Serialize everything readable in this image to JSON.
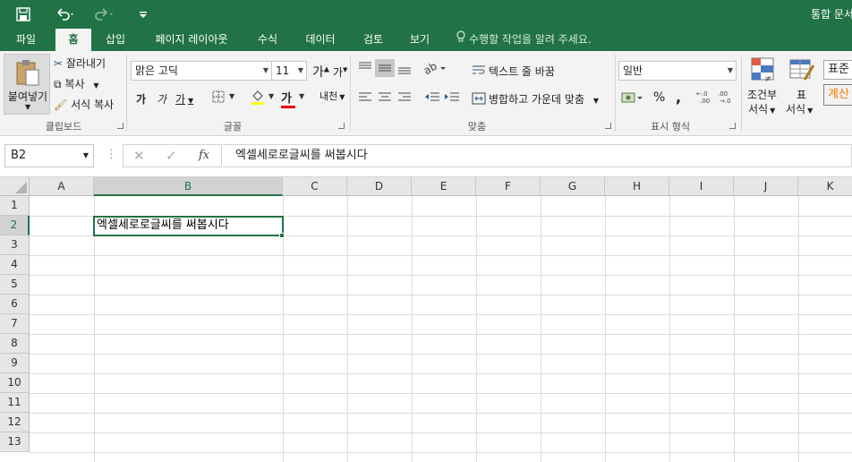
{
  "titlebar": {
    "doc_title": "통합 문서",
    "qat": {
      "save_icon": "save-icon",
      "undo_icon": "undo-icon",
      "redo_icon": "redo-icon",
      "customize_icon": "customize-qat-icon"
    }
  },
  "tabs": [
    {
      "label": "파일"
    },
    {
      "label": "홈"
    },
    {
      "label": "삽입"
    },
    {
      "label": "페이지 레이아웃"
    },
    {
      "label": "수식"
    },
    {
      "label": "데이터"
    },
    {
      "label": "검토"
    },
    {
      "label": "보기"
    }
  ],
  "tell_me": "수행할 작업을 알려 주세요.",
  "ribbon": {
    "clipboard": {
      "paste_label": "붙여넣기",
      "cut_label": "잘라내기",
      "copy_label": "복사",
      "format_painter_label": "서식 복사",
      "group_label": "클립보드"
    },
    "font": {
      "font_name": "맑은 고딕",
      "font_size": "11",
      "grow_label": "가",
      "shrink_label": "가",
      "bold_label": "가",
      "italic_label": "가",
      "underline_label": "가",
      "font_color_label": "가",
      "phonetic_label": "내천",
      "group_label": "글꼴"
    },
    "alignment": {
      "wrap_text_label": "텍스트 줄 바꿈",
      "merge_center_label": "병합하고 가운데 맞춤",
      "group_label": "맞춤"
    },
    "number": {
      "format_value": "일반",
      "percent_label": "%",
      "comma_label": ",",
      "group_label": "표시 형식"
    },
    "styles": {
      "conditional_label_1": "조건부",
      "conditional_label_2": "서식",
      "table_label_1": "표",
      "table_label_2": "서식",
      "style_normal": "표준",
      "style_calc": "계산"
    }
  },
  "formula_bar": {
    "name_box": "B2",
    "fx_label": "fx",
    "content": "엑셀세로로글씨를 써봅시다"
  },
  "sheet": {
    "columns": [
      "A",
      "B",
      "C",
      "D",
      "E",
      "F",
      "G",
      "H",
      "I",
      "J",
      "K"
    ],
    "rows": [
      "1",
      "2",
      "3",
      "4",
      "5",
      "6",
      "7",
      "8",
      "9",
      "10",
      "11",
      "12",
      "13"
    ],
    "selected_cell": "B2",
    "cells": {
      "B2": "엑셀세로로글씨를 써봅시다"
    }
  }
}
